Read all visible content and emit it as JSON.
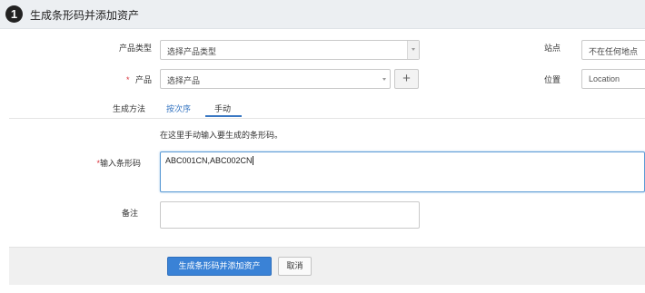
{
  "header": {
    "step_number": "1",
    "title": "生成条形码并添加资产"
  },
  "form": {
    "product_type": {
      "label": "产品类型",
      "value": "选择产品类型"
    },
    "product": {
      "required_mark": "*",
      "label": "产品",
      "value": "选择产品"
    },
    "site": {
      "label": "站点",
      "value": "不在任何地点"
    },
    "location": {
      "label": "位置",
      "value": "Location"
    },
    "method": {
      "label": "生成方法",
      "tabs": [
        {
          "label": "按次序",
          "active": false
        },
        {
          "label": "手动",
          "active": true
        }
      ]
    },
    "hint": "在这里手动输入要生成的条形码。",
    "barcode_input": {
      "required_mark": "*",
      "label": "输入条形码",
      "value": "ABC001CN,ABC002CN"
    },
    "notes": {
      "label": "备注",
      "value": ""
    }
  },
  "footer": {
    "submit_label": "生成条形码并添加资产",
    "cancel_label": "取消"
  },
  "icons": {
    "step": "step-number-icon",
    "dropdown": "chevron-down-icon",
    "add": "plus-icon"
  },
  "colors": {
    "primary": "#3a82d6",
    "link": "#3a78c3",
    "required": "#d9303a",
    "header_bg": "#eceff2"
  }
}
